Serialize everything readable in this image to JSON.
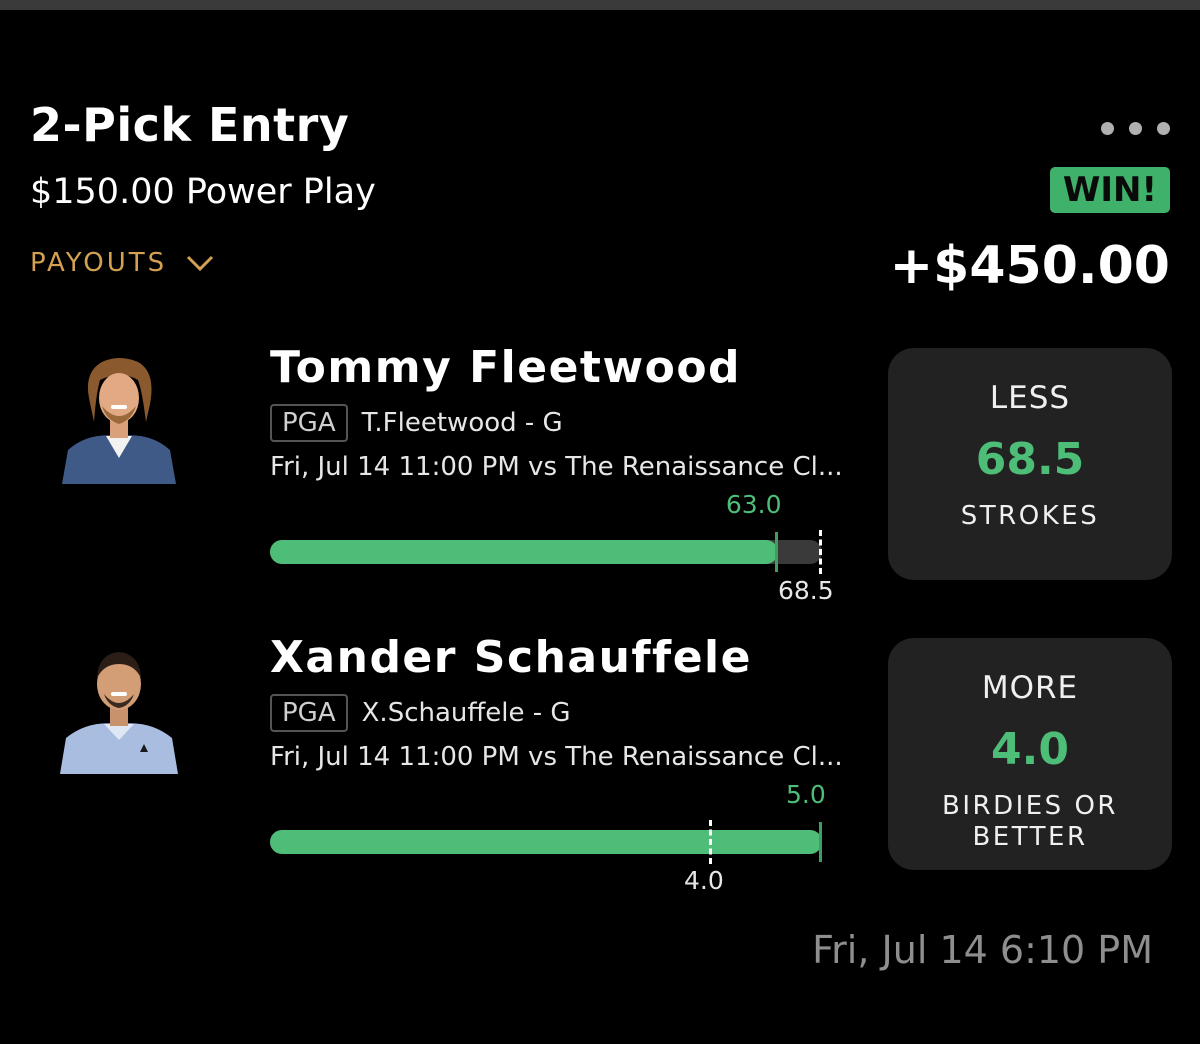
{
  "entry": {
    "title": "2-Pick Entry",
    "subtitle": "$150.00 Power Play",
    "payouts_label": "PAYOUTS",
    "result_badge": "WIN!",
    "result_amount": "+$450.00"
  },
  "colors": {
    "accent_green": "#4dbd78",
    "win_badge": "#3fb16a",
    "payouts_gold": "#d4a052",
    "card_bg": "#222222"
  },
  "picks": [
    {
      "player_name": "Tommy Fleetwood",
      "league": "PGA",
      "short_name": "T.Fleetwood - G",
      "game_info": "Fri, Jul 14 11:00 PM  vs The Renaissance Cl...",
      "direction": "LESS",
      "line": "68.5",
      "stat": "STROKES",
      "actual": "63.0",
      "actual_value": 63.0,
      "line_value": 68.5
    },
    {
      "player_name": "Xander Schauffele",
      "league": "PGA",
      "short_name": "X.Schauffele - G",
      "game_info": "Fri, Jul 14 11:00 PM  vs The Renaissance Cl...",
      "direction": "MORE",
      "line": "4.0",
      "stat": "BIRDIES OR BETTER",
      "actual": "5.0",
      "actual_value": 5.0,
      "line_value": 4.0
    }
  ],
  "timestamp": "Fri, Jul 14 6:10 PM"
}
